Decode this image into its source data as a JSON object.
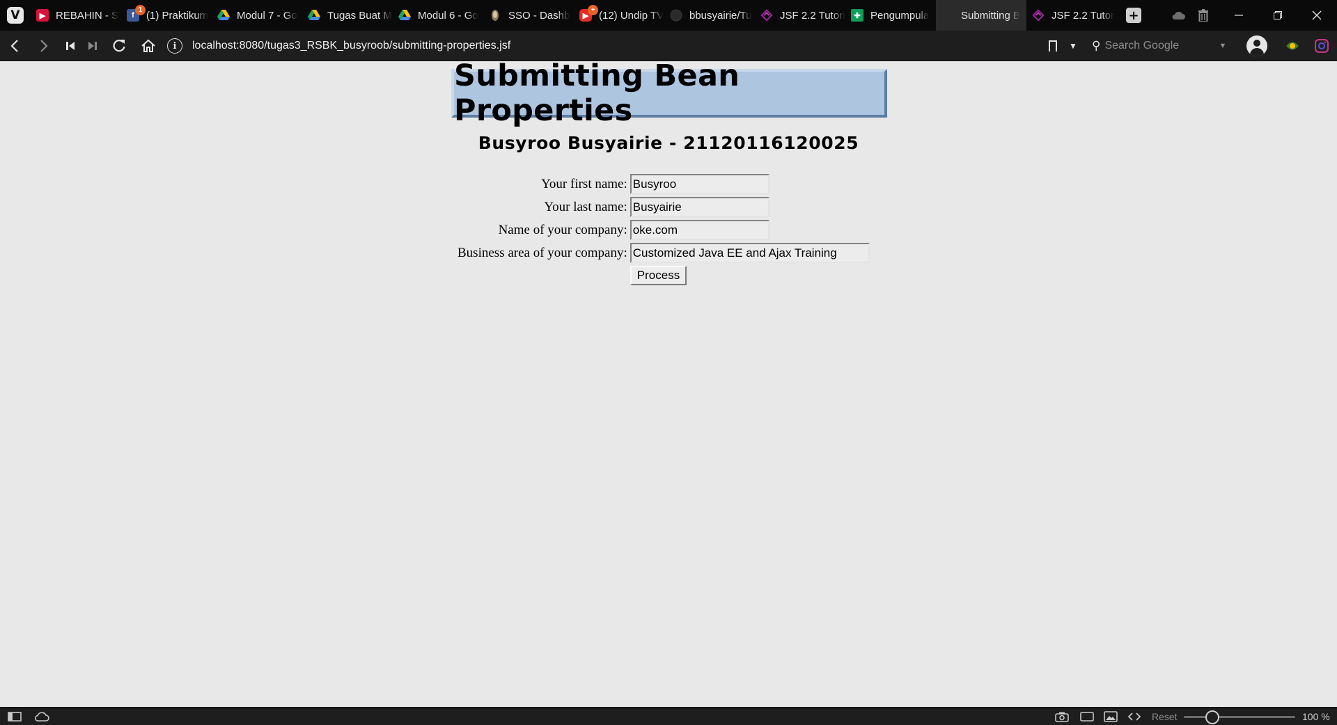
{
  "tabs": [
    {
      "label": "REBAHIN - S",
      "icon": "rebahin-icon",
      "badge": ""
    },
    {
      "label": "(1) Praktikum",
      "icon": "facebook-icon",
      "badge": "1"
    },
    {
      "label": "Modul 7 - Go",
      "icon": "google-drive-icon",
      "badge": ""
    },
    {
      "label": "Tugas Buat M",
      "icon": "google-drive-icon",
      "badge": ""
    },
    {
      "label": "Modul 6 - Go",
      "icon": "google-drive-icon",
      "badge": ""
    },
    {
      "label": "SSO - Dashb",
      "icon": "sso-icon",
      "badge": ""
    },
    {
      "label": "(12) Undip TV",
      "icon": "youtube-icon",
      "badge": "+"
    },
    {
      "label": "bbusyairie/Tu",
      "icon": "github-icon",
      "badge": ""
    },
    {
      "label": "JSF 2.2 Tutori",
      "icon": "jsf-icon",
      "badge": ""
    },
    {
      "label": "Pengumpula",
      "icon": "google-sheets-icon",
      "badge": ""
    },
    {
      "label": "Submitting B",
      "icon": "blank-page-icon",
      "badge": ""
    },
    {
      "label": "JSF 2.2 Tutor",
      "icon": "jsf-icon",
      "badge": ""
    }
  ],
  "active_tab_index": 10,
  "address": {
    "url": "localhost:8080/tugas3_RSBK_busyroob/submitting-properties.jsf",
    "search_placeholder": "Search Google"
  },
  "page": {
    "title": "Submitting Bean Properties",
    "subtitle": "Busyroo Busyairie - 21120116120025",
    "fields": [
      {
        "label": "Your first name:",
        "value": "Busyroo"
      },
      {
        "label": "Your last name:",
        "value": "Busyairie"
      },
      {
        "label": "Name of your company:",
        "value": "oke.com"
      },
      {
        "label": "Business area of your company:",
        "value": "Customized Java EE and Ajax Training"
      }
    ],
    "submit_label": "Process"
  },
  "statusbar": {
    "reset_label": "Reset",
    "zoom": "100 %",
    "zoom_percent": 100
  },
  "colors": {
    "title_box": "#aec5e0",
    "page_bg": "#e8e8e8",
    "chrome_dark": "#0a0a0a"
  }
}
